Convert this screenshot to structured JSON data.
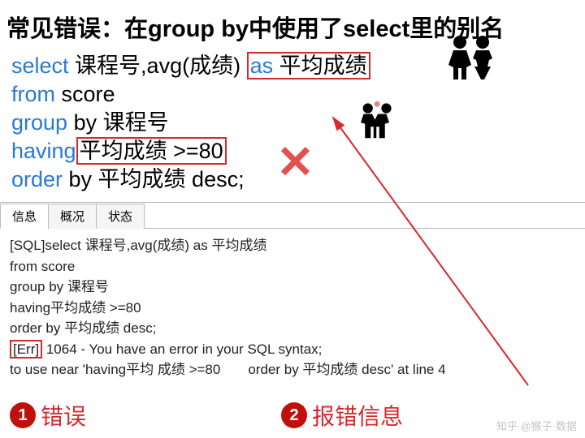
{
  "title": "常见错误：在group by中使用了select里的别名",
  "sql": {
    "l1_kw1": "select",
    "l1_t1": " 课程号,avg(成绩) ",
    "l1_kw2": "as",
    "l1_alias": " 平均成绩",
    "l2_kw": "from",
    "l2_t": " score",
    "l3_kw": "group",
    "l3_t": " by 课程号",
    "l4_kw": "having",
    "l4_box": "平均成绩 >=80",
    "l5_kw": "order",
    "l5_t": " by 平均成绩 desc;"
  },
  "cross": "✕",
  "tabs": {
    "t1": "信息",
    "t2": "概况",
    "t3": "状态"
  },
  "msg": {
    "m1": "[SQL]select 课程号,avg(成绩) as 平均成绩",
    "m2": "from score",
    "m3": "group by 课程号",
    "m4": "having平均成绩 >=80",
    "m5": "order by 平均成绩 desc;",
    "errLabel": "[Err]",
    "errTail": " 1064 - You have an error in your SQL syntax;",
    "m7": "to use near 'having平均 成绩 >=80　　order by 平均成绩 desc' at line 4"
  },
  "callouts": {
    "n1": "1",
    "t1": "错误",
    "n2": "2",
    "t2": "报错信息"
  },
  "watermark": "知乎 @猴子·数据",
  "colors": {
    "red": "#d7282e",
    "blue": "#2979d6"
  }
}
